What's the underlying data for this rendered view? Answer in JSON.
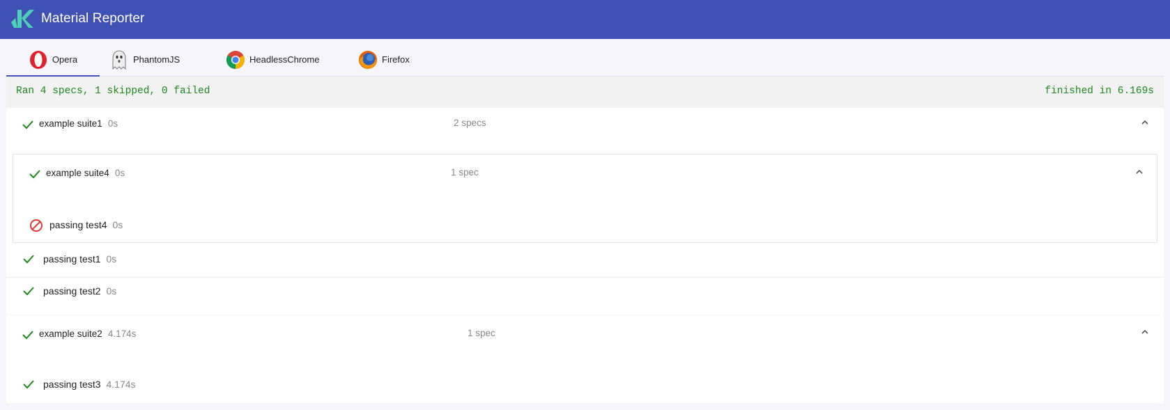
{
  "app": {
    "title": "Material Reporter"
  },
  "tabs": [
    {
      "label": "Opera",
      "icon": "opera-icon",
      "active": true
    },
    {
      "label": "PhantomJS",
      "icon": "phantomjs-icon",
      "active": false
    },
    {
      "label": "HeadlessChrome",
      "icon": "chrome-icon",
      "active": false
    },
    {
      "label": "Firefox",
      "icon": "firefox-icon",
      "active": false
    }
  ],
  "summary": {
    "left": "Ran 4 specs, 1 skipped, 0 failed",
    "right": "finished in 6.169s"
  },
  "suites": [
    {
      "name": "example suite1",
      "time": "0s",
      "count": "2 specs",
      "status": "passed",
      "children": [
        {
          "name": "example suite4",
          "time": "0s",
          "count": "1 spec",
          "status": "passed",
          "tests": [
            {
              "name": "passing test4",
              "time": "0s",
              "status": "skipped"
            }
          ]
        }
      ],
      "tests": [
        {
          "name": "passing test1",
          "time": "0s",
          "status": "passed"
        },
        {
          "name": "passing test2",
          "time": "0s",
          "status": "passed"
        }
      ]
    },
    {
      "name": "example suite2",
      "time": "4.174s",
      "count": "1 spec",
      "status": "passed",
      "tests": [
        {
          "name": "passing test3",
          "time": "4.174s",
          "status": "passed"
        }
      ]
    }
  ],
  "colors": {
    "header": "#3f51b5",
    "pass": "#1b8a1b",
    "skip": "#e53935",
    "summary_text": "#1b8a1b"
  }
}
